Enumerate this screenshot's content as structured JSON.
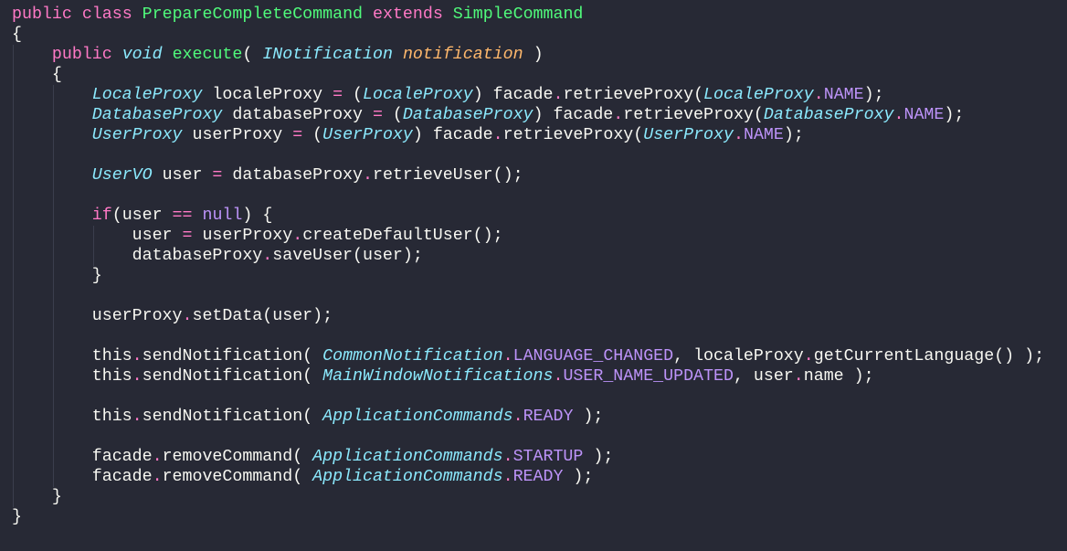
{
  "colors": {
    "background": "#272935",
    "keyword": "#ff79c6",
    "type": "#8be9fd",
    "function": "#50fa7b",
    "parameter": "#ffb86c",
    "constant": "#bd93f9",
    "text": "#f8f8f2"
  },
  "lines": [
    [
      [
        "kw",
        "public"
      ],
      [
        "tx",
        " "
      ],
      [
        "kw",
        "class"
      ],
      [
        "tx",
        " "
      ],
      [
        "fn",
        "PrepareCompleteCommand"
      ],
      [
        "tx",
        " "
      ],
      [
        "kw",
        "extends"
      ],
      [
        "tx",
        " "
      ],
      [
        "fn",
        "SimpleCommand"
      ]
    ],
    [
      [
        "tx",
        "{"
      ]
    ],
    [
      [
        "tx",
        "    "
      ],
      [
        "kw",
        "public"
      ],
      [
        "tx",
        " "
      ],
      [
        "ikw",
        "void"
      ],
      [
        "tx",
        " "
      ],
      [
        "fn",
        "execute"
      ],
      [
        "tx",
        "( "
      ],
      [
        "ty",
        "INotification"
      ],
      [
        "tx",
        " "
      ],
      [
        "pa",
        "notification"
      ],
      [
        "tx",
        " )"
      ]
    ],
    [
      [
        "tx",
        "    {"
      ]
    ],
    [
      [
        "tx",
        "        "
      ],
      [
        "ty",
        "LocaleProxy"
      ],
      [
        "tx",
        " localeProxy "
      ],
      [
        "op",
        "="
      ],
      [
        "tx",
        " ("
      ],
      [
        "ty",
        "LocaleProxy"
      ],
      [
        "tx",
        ") facade"
      ],
      [
        "op",
        "."
      ],
      [
        "tx",
        "retrieveProxy("
      ],
      [
        "ty",
        "LocaleProxy"
      ],
      [
        "op",
        "."
      ],
      [
        "cn",
        "NAME"
      ],
      [
        "tx",
        ");"
      ]
    ],
    [
      [
        "tx",
        "        "
      ],
      [
        "ty",
        "DatabaseProxy"
      ],
      [
        "tx",
        " databaseProxy "
      ],
      [
        "op",
        "="
      ],
      [
        "tx",
        " ("
      ],
      [
        "ty",
        "DatabaseProxy"
      ],
      [
        "tx",
        ") facade"
      ],
      [
        "op",
        "."
      ],
      [
        "tx",
        "retrieveProxy("
      ],
      [
        "ty",
        "DatabaseProxy"
      ],
      [
        "op",
        "."
      ],
      [
        "cn",
        "NAME"
      ],
      [
        "tx",
        ");"
      ]
    ],
    [
      [
        "tx",
        "        "
      ],
      [
        "ty",
        "UserProxy"
      ],
      [
        "tx",
        " userProxy "
      ],
      [
        "op",
        "="
      ],
      [
        "tx",
        " ("
      ],
      [
        "ty",
        "UserProxy"
      ],
      [
        "tx",
        ") facade"
      ],
      [
        "op",
        "."
      ],
      [
        "tx",
        "retrieveProxy("
      ],
      [
        "ty",
        "UserProxy"
      ],
      [
        "op",
        "."
      ],
      [
        "cn",
        "NAME"
      ],
      [
        "tx",
        ");"
      ]
    ],
    [],
    [
      [
        "tx",
        "        "
      ],
      [
        "ty",
        "UserVO"
      ],
      [
        "tx",
        " user "
      ],
      [
        "op",
        "="
      ],
      [
        "tx",
        " databaseProxy"
      ],
      [
        "op",
        "."
      ],
      [
        "tx",
        "retrieveUser();"
      ]
    ],
    [],
    [
      [
        "tx",
        "        "
      ],
      [
        "kw",
        "if"
      ],
      [
        "tx",
        "(user "
      ],
      [
        "op",
        "=="
      ],
      [
        "tx",
        " "
      ],
      [
        "cn",
        "null"
      ],
      [
        "tx",
        ") {"
      ]
    ],
    [
      [
        "tx",
        "            user "
      ],
      [
        "op",
        "="
      ],
      [
        "tx",
        " userProxy"
      ],
      [
        "op",
        "."
      ],
      [
        "tx",
        "createDefaultUser();"
      ]
    ],
    [
      [
        "tx",
        "            databaseProxy"
      ],
      [
        "op",
        "."
      ],
      [
        "tx",
        "saveUser(user);"
      ]
    ],
    [
      [
        "tx",
        "        }"
      ]
    ],
    [],
    [
      [
        "tx",
        "        userProxy"
      ],
      [
        "op",
        "."
      ],
      [
        "tx",
        "setData(user);"
      ]
    ],
    [],
    [
      [
        "tx",
        "        this"
      ],
      [
        "op",
        "."
      ],
      [
        "tx",
        "sendNotification( "
      ],
      [
        "ty",
        "CommonNotification"
      ],
      [
        "op",
        "."
      ],
      [
        "cn",
        "LANGUAGE_CHANGED"
      ],
      [
        "tx",
        ", localeProxy"
      ],
      [
        "op",
        "."
      ],
      [
        "tx",
        "getCurrentLanguage() );"
      ]
    ],
    [
      [
        "tx",
        "        this"
      ],
      [
        "op",
        "."
      ],
      [
        "tx",
        "sendNotification( "
      ],
      [
        "ty",
        "MainWindowNotifications"
      ],
      [
        "op",
        "."
      ],
      [
        "cn",
        "USER_NAME_UPDATED"
      ],
      [
        "tx",
        ", user"
      ],
      [
        "op",
        "."
      ],
      [
        "tx",
        "name );"
      ]
    ],
    [],
    [
      [
        "tx",
        "        this"
      ],
      [
        "op",
        "."
      ],
      [
        "tx",
        "sendNotification( "
      ],
      [
        "ty",
        "ApplicationCommands"
      ],
      [
        "op",
        "."
      ],
      [
        "cn",
        "READY"
      ],
      [
        "tx",
        " );"
      ]
    ],
    [],
    [
      [
        "tx",
        "        facade"
      ],
      [
        "op",
        "."
      ],
      [
        "tx",
        "removeCommand( "
      ],
      [
        "ty",
        "ApplicationCommands"
      ],
      [
        "op",
        "."
      ],
      [
        "cn",
        "STARTUP"
      ],
      [
        "tx",
        " );"
      ]
    ],
    [
      [
        "tx",
        "        facade"
      ],
      [
        "op",
        "."
      ],
      [
        "tx",
        "removeCommand( "
      ],
      [
        "ty",
        "ApplicationCommands"
      ],
      [
        "op",
        "."
      ],
      [
        "cn",
        "READY"
      ],
      [
        "tx",
        " );"
      ]
    ],
    [
      [
        "tx",
        "    }"
      ]
    ],
    [
      [
        "tx",
        "}"
      ]
    ]
  ]
}
